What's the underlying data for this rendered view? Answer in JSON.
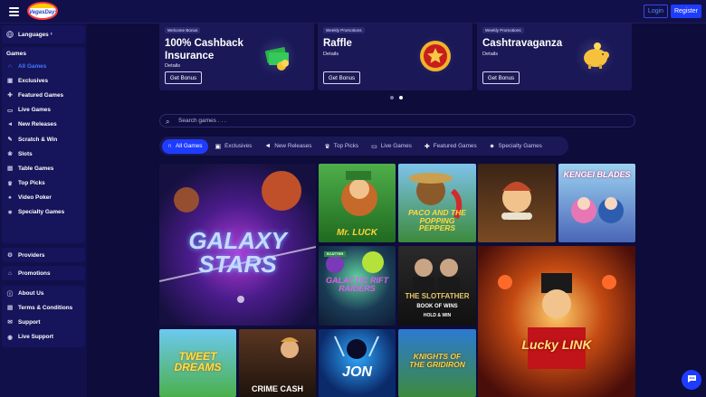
{
  "header": {
    "logo_text": "VegasDays",
    "login_label": "Login",
    "register_label": "Register"
  },
  "sidebar": {
    "languages_label": "Languages",
    "games_heading": "Games",
    "game_items": [
      {
        "label": "All Games",
        "icon": "horseshoe-icon",
        "active": true
      },
      {
        "label": "Exclusives",
        "icon": "exclusive-icon"
      },
      {
        "label": "Featured Games",
        "icon": "puzzle-icon"
      },
      {
        "label": "Live Games",
        "icon": "tv-icon"
      },
      {
        "label": "New Releases",
        "icon": "megaphone-icon"
      },
      {
        "label": "Scratch & Win",
        "icon": "scratch-icon"
      },
      {
        "label": "Slots",
        "icon": "cherry-icon"
      },
      {
        "label": "Table Games",
        "icon": "cards-icon"
      },
      {
        "label": "Top Picks",
        "icon": "crown-icon"
      },
      {
        "label": "Video Poker",
        "icon": "poker-icon"
      },
      {
        "label": "Specialty Games",
        "icon": "gear-icon"
      }
    ],
    "providers_label": "Providers",
    "promotions_label": "Promotions",
    "info_items": [
      {
        "label": "About Us",
        "icon": "info-icon"
      },
      {
        "label": "Terms & Conditions",
        "icon": "document-icon"
      },
      {
        "label": "Support",
        "icon": "mail-icon"
      },
      {
        "label": "Live Support",
        "icon": "chat-icon"
      }
    ]
  },
  "promos": [
    {
      "tag": "Welcome Bonus",
      "title": "100% Cashback Insurance",
      "details": "Details",
      "button": "Get Bonus",
      "art": "money-stack-icon"
    },
    {
      "tag": "Weekly Promotions",
      "title": "Raffle",
      "details": "Details",
      "button": "Get Bonus",
      "art": "star-coin-icon"
    },
    {
      "tag": "Weekly Promotions",
      "title": "Cashtravaganza",
      "details": "Details",
      "button": "Get Bonus",
      "art": "piggy-bank-icon"
    }
  ],
  "carousel": {
    "pages": 2,
    "active_page": 2
  },
  "search": {
    "placeholder": "Search games . . ."
  },
  "filters": [
    {
      "label": "All Games",
      "icon": "horseshoe-icon",
      "active": true
    },
    {
      "label": "Exclusives",
      "icon": "exclusive-icon"
    },
    {
      "label": "New Releases",
      "icon": "megaphone-icon"
    },
    {
      "label": "Top Picks",
      "icon": "crown-icon"
    },
    {
      "label": "Live Games",
      "icon": "tv-icon"
    },
    {
      "label": "Featured Games",
      "icon": "puzzle-icon"
    },
    {
      "label": "Specialty Games",
      "icon": "gear-icon"
    }
  ],
  "games": [
    {
      "title": "GALAXY STARS"
    },
    {
      "title": "Mr. LUCK"
    },
    {
      "title": "PACO AND THE POPPING PEPPERS"
    },
    {
      "title": ""
    },
    {
      "title": "KENGEI BLADES"
    },
    {
      "title": "GALACTIC RIFT RAIDERS",
      "badge": "SCATTER"
    },
    {
      "title": "THE SLOTFATHER",
      "subtitle": "BOOK OF WINS",
      "extra": "HOLD & WIN"
    },
    {
      "title": "Lucky LINK"
    },
    {
      "title": "TWEET DREAMS"
    },
    {
      "title": "CRIME CASH"
    },
    {
      "title": "JON"
    },
    {
      "title": "KNIGHTS OF THE GRIDIRON"
    }
  ],
  "colors": {
    "accent": "#1e3cff",
    "background": "#0d0c3a",
    "panel": "#1a1856",
    "sidebar": "#12104a"
  }
}
